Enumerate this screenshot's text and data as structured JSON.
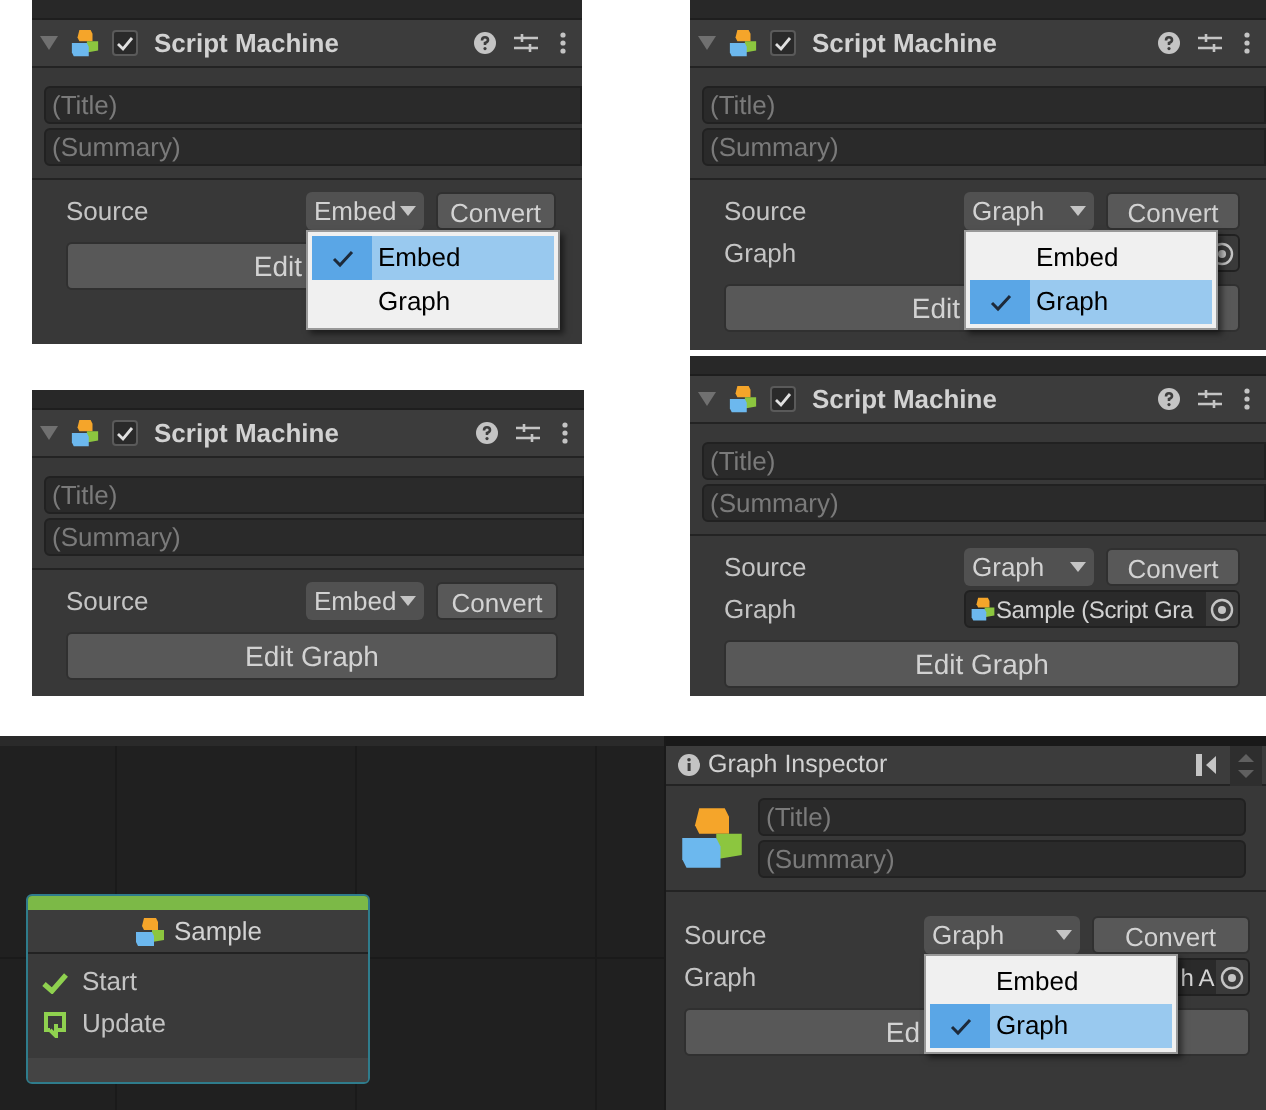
{
  "panels": [
    {
      "kind": "component",
      "title": "Script Machine",
      "enabled": true,
      "title_placeholder": "(Title)",
      "summary_placeholder": "(Summary)",
      "source_label": "Source",
      "source_value": "Embed",
      "convert": "Convert",
      "edit_button": "Edit",
      "dropdown": {
        "options": [
          {
            "label": "Embed",
            "selected": true
          },
          {
            "label": "Graph",
            "selected": false
          }
        ]
      }
    },
    {
      "kind": "component",
      "title": "Script Machine",
      "enabled": true,
      "title_placeholder": "(Title)",
      "summary_placeholder": "(Summary)",
      "source_label": "Source",
      "source_value": "Graph",
      "convert": "Convert",
      "graph_label": "Graph",
      "graph_field": true,
      "edit_button": "Edit",
      "dropdown": {
        "options": [
          {
            "label": "Embed",
            "selected": false
          },
          {
            "label": "Graph",
            "selected": true
          }
        ]
      }
    },
    {
      "kind": "component",
      "title": "Script Machine",
      "enabled": true,
      "title_placeholder": "(Title)",
      "summary_placeholder": "(Summary)",
      "source_label": "Source",
      "source_value": "Embed",
      "convert": "Convert",
      "edit_button": "Edit Graph"
    },
    {
      "kind": "component",
      "title": "Script Machine",
      "enabled": true,
      "title_placeholder": "(Title)",
      "summary_placeholder": "(Summary)",
      "source_label": "Source",
      "source_value": "Graph",
      "convert": "Convert",
      "graph_label": "Graph",
      "graph_field": {
        "value": "Sample (Script Gra"
      },
      "edit_button": "Edit Graph"
    },
    {
      "kind": "graph",
      "node": {
        "title": "Sample",
        "ports": [
          {
            "kind": "start",
            "label": "Start"
          },
          {
            "kind": "update",
            "label": "Update"
          }
        ]
      }
    },
    {
      "kind": "inspector",
      "title": "Graph Inspector",
      "title_placeholder": "(Title)",
      "summary_placeholder": "(Summary)",
      "source_label": "Source",
      "source_value": "Graph",
      "convert": "Convert",
      "graph_label": "Graph",
      "graph_field": {
        "value": "h A"
      },
      "edit_button": "Ed",
      "dropdown": {
        "options": [
          {
            "label": "Embed",
            "selected": false
          },
          {
            "label": "Graph",
            "selected": true
          }
        ]
      }
    }
  ]
}
